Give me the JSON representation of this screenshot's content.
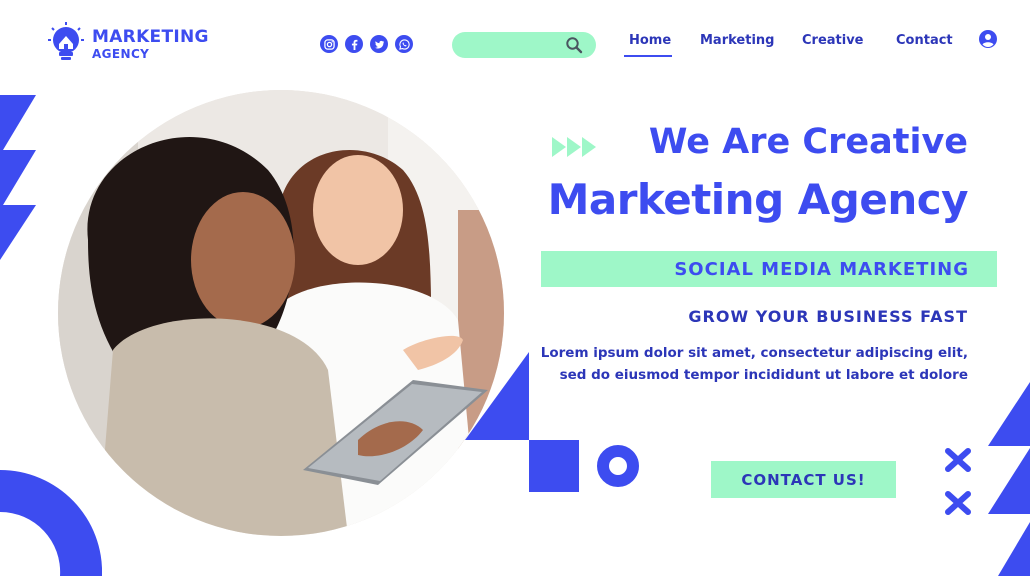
{
  "brand": {
    "line1": "MARKETING",
    "line2": "AGENCY",
    "icon": "lightbulb-house-icon"
  },
  "socials": [
    {
      "name": "instagram-icon",
      "glyph": "◎"
    },
    {
      "name": "facebook-icon",
      "glyph": "f"
    },
    {
      "name": "twitter-icon",
      "glyph": "🐦"
    },
    {
      "name": "whatsapp-icon",
      "glyph": "✆"
    }
  ],
  "search": {
    "value": "",
    "icon": "search-icon"
  },
  "nav": {
    "items": [
      "Home",
      "Marketing",
      "Creative",
      "Contact"
    ],
    "active": "Home",
    "user_icon": "user-icon"
  },
  "hero": {
    "title_line1": "We Are Creative",
    "title_line2": "Marketing Agency",
    "band_text": "SOCIAL MEDIA MARKETING",
    "subheading": "GROW YOUR BUSINESS FAST",
    "body": "Lorem ipsum dolor sit amet, consectetur adipiscing elit, sed do eiusmod tempor incididunt ut labore et dolore",
    "cta": "CONTACT US!",
    "photo_icon": "two-women-with-tablet-photo"
  },
  "colors": {
    "primary": "#3d4cf0",
    "primary_dark": "#2c36b8",
    "accent": "#9ef7c8",
    "background": "#ffffff"
  }
}
